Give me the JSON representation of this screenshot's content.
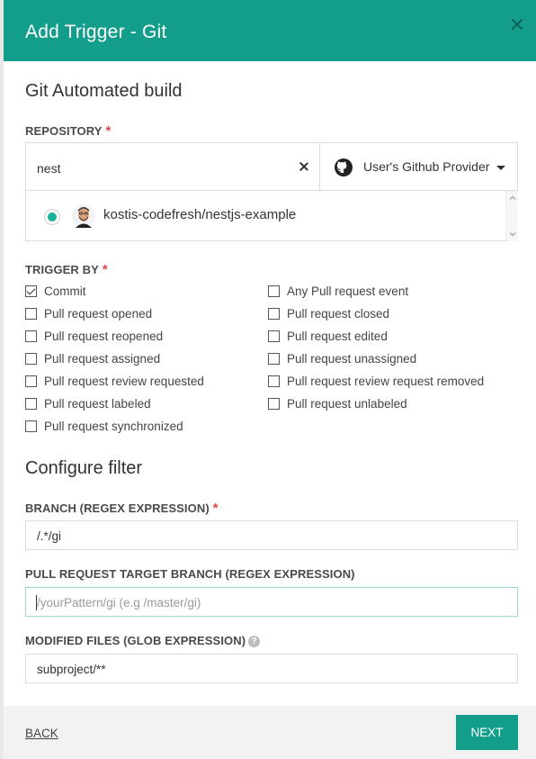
{
  "header": {
    "title": "Add Trigger - Git"
  },
  "section": {
    "title": "Git Automated build"
  },
  "repository": {
    "label": "REPOSITORY",
    "required_mark": "*",
    "search_value": "nest",
    "provider_label": "User's Github Provider",
    "selected_repo": "kostis-codefresh/nestjs-example"
  },
  "trigger_by": {
    "label": "TRIGGER BY",
    "required_mark": "*",
    "options": [
      {
        "label": "Commit",
        "checked": true
      },
      {
        "label": "Any Pull request event",
        "checked": false
      },
      {
        "label": "Pull request opened",
        "checked": false
      },
      {
        "label": "Pull request closed",
        "checked": false
      },
      {
        "label": "Pull request reopened",
        "checked": false
      },
      {
        "label": "Pull request edited",
        "checked": false
      },
      {
        "label": "Pull request assigned",
        "checked": false
      },
      {
        "label": "Pull request unassigned",
        "checked": false
      },
      {
        "label": "Pull request review requested",
        "checked": false
      },
      {
        "label": "Pull request review request removed",
        "checked": false
      },
      {
        "label": "Pull request labeled",
        "checked": false
      },
      {
        "label": "Pull request unlabeled",
        "checked": false
      },
      {
        "label": "Pull request synchronized",
        "checked": false
      }
    ]
  },
  "filter": {
    "title": "Configure filter",
    "branch_label": "BRANCH (REGEX EXPRESSION)",
    "branch_required_mark": "*",
    "branch_value": "/.*/gi",
    "pr_target_label": "PULL REQUEST TARGET BRANCH (REGEX EXPRESSION)",
    "pr_target_placeholder": "/yourPattern/gi  (e.g /master/gi)",
    "modified_files_label": "MODIFIED FILES (GLOB EXPRESSION)",
    "help_glyph": "?",
    "modified_files_value": "subproject/**"
  },
  "footer": {
    "back_label": "BACK",
    "next_label": "NEXT"
  },
  "colors": {
    "accent": "#139e8b",
    "required": "#e0454b",
    "radio": "#19b39c"
  }
}
